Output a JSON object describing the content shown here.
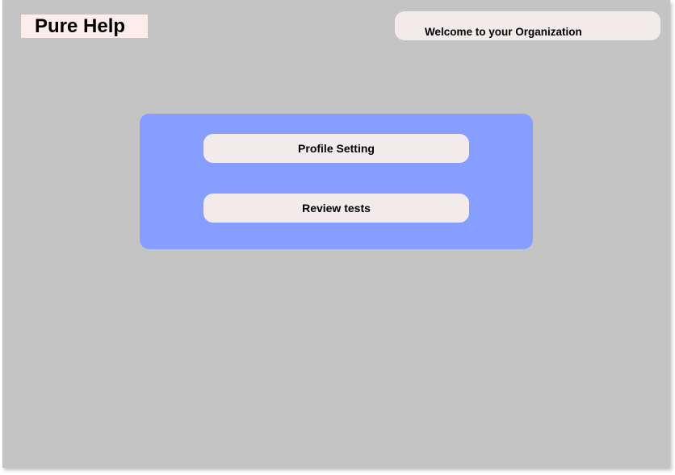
{
  "header": {
    "logo_text": "Pure Help",
    "welcome_text": "Welcome to your Organization"
  },
  "menu": {
    "items": [
      {
        "label": "Profile Setting"
      },
      {
        "label": "Review tests"
      }
    ]
  },
  "colors": {
    "background": "#c4c4c4",
    "panel": "#859eff",
    "button": "#f3ebeb",
    "logo_bg": "#fdecec"
  }
}
